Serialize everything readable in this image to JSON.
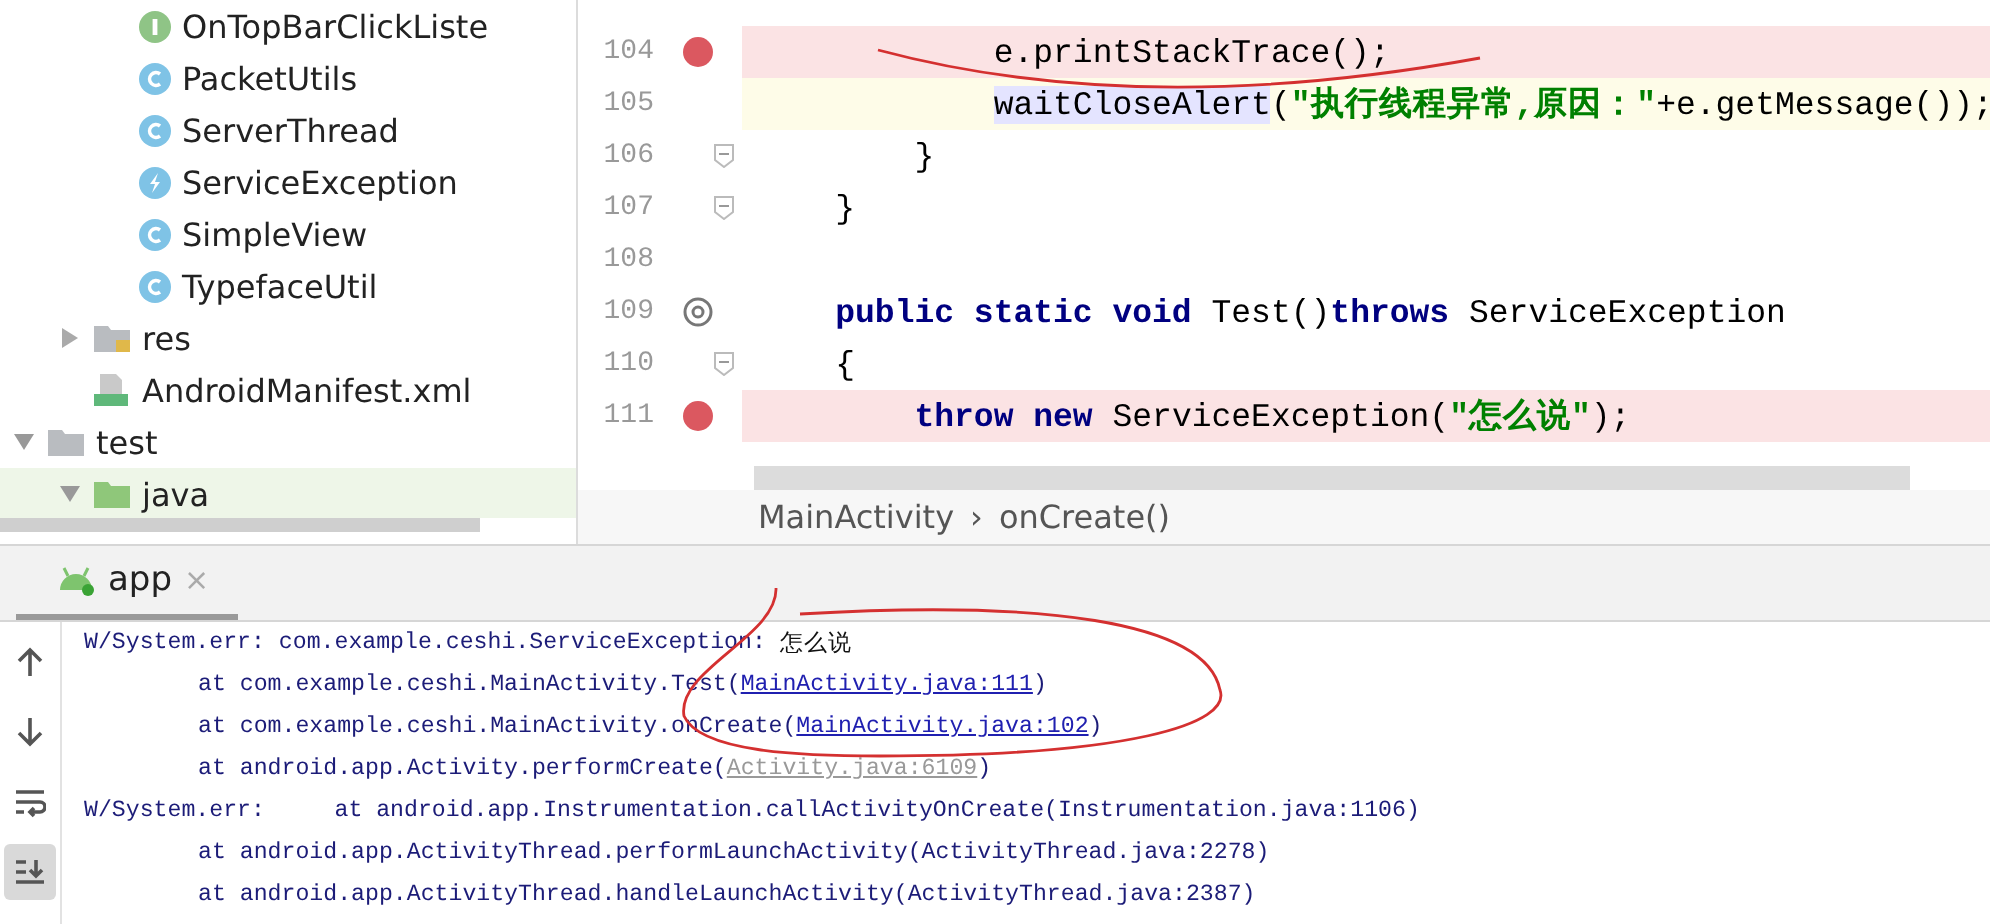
{
  "project_tree": [
    {
      "children": [
        {
          "children": [
            {
              "label": "OnTopBarClickListe",
              "kind": "interface"
            },
            {
              "label": "PacketUtils",
              "kind": "class"
            },
            {
              "label": "ServerThread",
              "kind": "class"
            },
            {
              "label": "ServiceException",
              "kind": "exception"
            },
            {
              "label": "SimpleView",
              "kind": "class"
            },
            {
              "label": "TypefaceUtil",
              "kind": "class"
            }
          ]
        },
        {
          "label": "res",
          "kind": "res-folder",
          "expanded": false
        },
        {
          "label": "AndroidManifest.xml",
          "kind": "manifest"
        }
      ]
    },
    {
      "label": "test",
      "kind": "folder",
      "expanded": true,
      "children": [
        {
          "label": "java",
          "kind": "test-folder",
          "expanded": true
        }
      ]
    }
  ],
  "editor": {
    "lines": [
      {
        "number": "104",
        "breakpoint": true,
        "override": false,
        "fold": false,
        "current": false,
        "tokens": [
          {
            "text": "            e.printStackTrace();",
            "kind": "plain"
          }
        ]
      },
      {
        "number": "105",
        "breakpoint": false,
        "override": false,
        "fold": false,
        "current": true,
        "tokens": [
          {
            "text": "            waitCloseAlert",
            "kind": "usage"
          },
          {
            "text": "(",
            "kind": "plain"
          },
          {
            "text": "\"执行线程异常,原因：\"",
            "kind": "string"
          },
          {
            "text": "+e.getMessage());",
            "kind": "plain"
          }
        ]
      },
      {
        "number": "106",
        "breakpoint": false,
        "override": false,
        "fold": true,
        "current": false,
        "tokens": [
          {
            "text": "        }",
            "kind": "plain"
          }
        ]
      },
      {
        "number": "107",
        "breakpoint": false,
        "override": false,
        "fold": true,
        "current": false,
        "tokens": [
          {
            "text": "    }",
            "kind": "plain"
          }
        ]
      },
      {
        "number": "108",
        "breakpoint": false,
        "override": false,
        "fold": false,
        "current": false
      },
      {
        "number": "109",
        "breakpoint": false,
        "override": true,
        "fold": false,
        "current": false,
        "tokens": [
          {
            "text": "    public static void",
            "kind": "keyword"
          },
          {
            "text": " Test()",
            "kind": "plain"
          },
          {
            "text": "throws",
            "kind": "keyword"
          },
          {
            "text": " ServiceException",
            "kind": "plain"
          }
        ]
      },
      {
        "number": "110",
        "breakpoint": false,
        "override": false,
        "fold": true,
        "current": false,
        "tokens": [
          {
            "text": "    {",
            "kind": "plain"
          }
        ]
      },
      {
        "number": "111",
        "breakpoint": true,
        "override": false,
        "fold": false,
        "current": false,
        "tokens": [
          {
            "text": "        throw new",
            "kind": "keyword"
          },
          {
            "text": " ServiceException(",
            "kind": "plain"
          },
          {
            "text": "\"怎么说\"",
            "kind": "string"
          },
          {
            "text": ");",
            "kind": "plain"
          }
        ]
      }
    ],
    "breadcrumbs": [
      "MainActivity",
      "onCreate()"
    ],
    "breadcrumb_separator": "›"
  },
  "tool_tabs": [
    {
      "label": "app",
      "selected": true,
      "close": "×"
    }
  ],
  "console": {
    "toolbar": [
      {
        "kind": "up",
        "selected": false
      },
      {
        "kind": "down",
        "selected": false
      },
      {
        "kind": "wrap",
        "selected": false
      },
      {
        "kind": "scroll-end",
        "selected": true
      }
    ],
    "lines": [
      {
        "indented": false,
        "parts": [
          {
            "text": "W/System.err: com.example.ceshi.ServiceException: ",
            "kind": "plain"
          },
          {
            "text": "怎么说",
            "kind": "message"
          }
        ]
      },
      {
        "indented": true,
        "parts": [
          {
            "text": "at com.example.ceshi.MainActivity.Test(",
            "kind": "plain"
          },
          {
            "text": "MainActivity.java:111",
            "kind": "link"
          },
          {
            "text": ")",
            "kind": "plain"
          }
        ]
      },
      {
        "indented": true,
        "parts": [
          {
            "text": "at com.example.ceshi.MainActivity.onCreate(",
            "kind": "plain"
          },
          {
            "text": "MainActivity.java:102",
            "kind": "link"
          },
          {
            "text": ")",
            "kind": "plain"
          }
        ]
      },
      {
        "indented": true,
        "parts": [
          {
            "text": "at android.app.Activity.performCreate(",
            "kind": "plain"
          },
          {
            "text": "Activity.java:6109",
            "kind": "library-link"
          },
          {
            "text": ")",
            "kind": "plain"
          }
        ]
      },
      {
        "indented": false,
        "parts": [
          {
            "text": "W/System.err:     at android.app.Instrumentation.callActivityOnCreate(Instrumentation.java:1106)",
            "kind": "plain"
          }
        ]
      },
      {
        "indented": true,
        "parts": [
          {
            "text": "at android.app.ActivityThread.performLaunchActivity(ActivityThread.java:2278)",
            "kind": "plain"
          }
        ]
      },
      {
        "indented": true,
        "parts": [
          {
            "text": "at android.app.ActivityThread.handleLaunchActivity(ActivityThread.java:2387)",
            "kind": "plain"
          }
        ]
      }
    ]
  }
}
